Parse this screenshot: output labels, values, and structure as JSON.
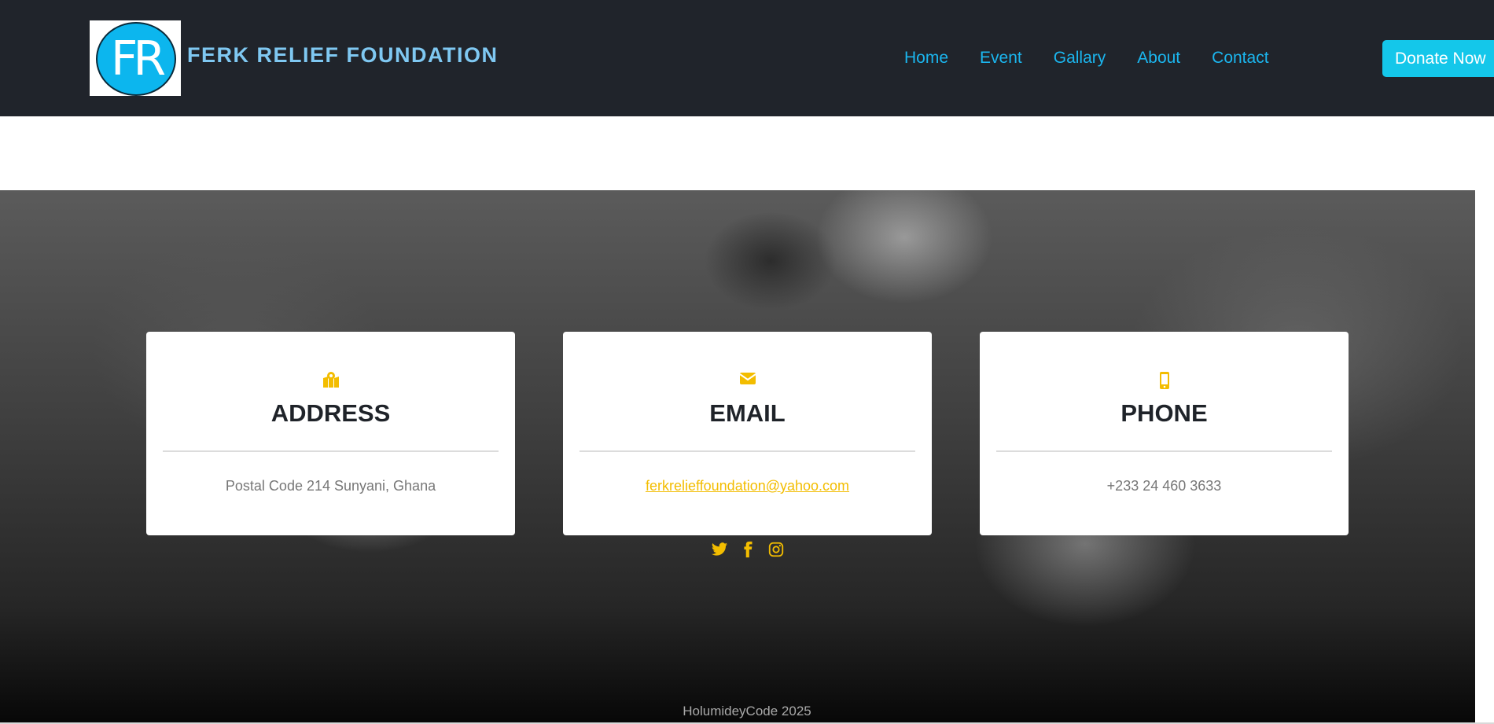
{
  "header": {
    "logo_text": "FR",
    "brand": "FERK RELIEF FOUNDATION",
    "nav": [
      {
        "label": "Home"
      },
      {
        "label": "Event"
      },
      {
        "label": "Gallary"
      },
      {
        "label": "About"
      },
      {
        "label": "Contact"
      }
    ],
    "donate_label": "Donate Now"
  },
  "contact_cards": [
    {
      "icon": "map-location-icon",
      "title": "ADDRESS",
      "value": "Postal Code 214 Sunyani, Ghana"
    },
    {
      "icon": "envelope-icon",
      "title": "EMAIL",
      "value": "ferkrelieffoundation@yahoo.com"
    },
    {
      "icon": "mobile-phone-icon",
      "title": "PHONE",
      "value": "+233 24 460 3633"
    }
  ],
  "socials": [
    "twitter-icon",
    "facebook-icon",
    "instagram-icon"
  ],
  "footer": {
    "copyright": "HolumideyCode 2025"
  },
  "colors": {
    "navbar": "#20242b",
    "nav_link": "#1bb6ef",
    "donate_button": "#14c7ea",
    "accent_yellow": "#f3bd00",
    "brand_text": "#7fc8f2"
  }
}
